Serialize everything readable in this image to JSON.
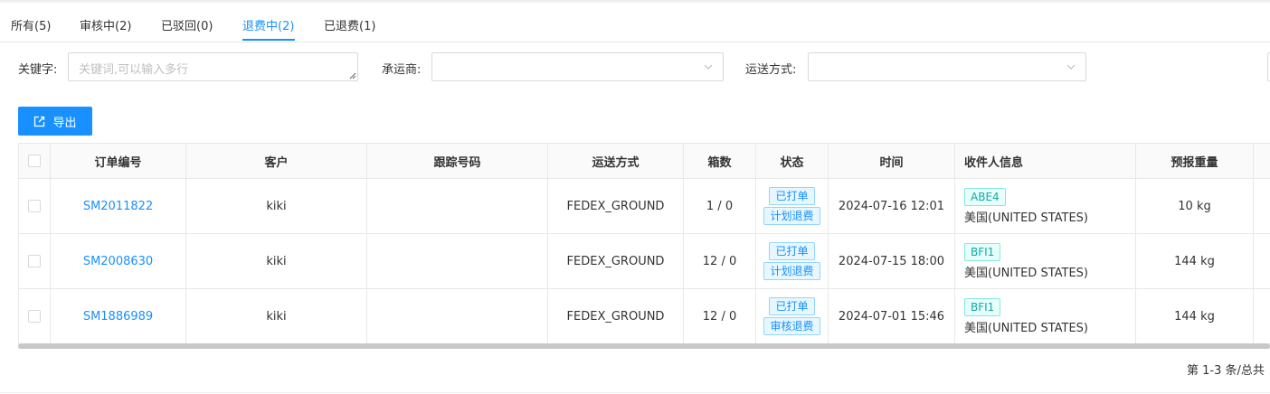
{
  "tabs": [
    {
      "label": "所有(5)",
      "active": false
    },
    {
      "label": "审核中(2)",
      "active": false
    },
    {
      "label": "已驳回(0)",
      "active": false
    },
    {
      "label": "退费中(2)",
      "active": true
    },
    {
      "label": "已退费(1)",
      "active": false
    }
  ],
  "filters": {
    "keyword_label": "关键字:",
    "keyword_placeholder": "关键词,可以输入多行",
    "carrier_label": "承运商:",
    "shipping_label": "运送方式:"
  },
  "toolbar": {
    "export_label": "导出"
  },
  "table": {
    "columns": [
      "订单编号",
      "客户",
      "跟踪号码",
      "运送方式",
      "箱数",
      "状态",
      "时间",
      "收件人信息",
      "预报重量"
    ],
    "rows": [
      {
        "order_no": "SM2011822",
        "customer": "kiki",
        "tracking": "",
        "shipping": "FEDEX_GROUND",
        "boxes": "1 / 0",
        "status1": "已打单",
        "status2": "计划退费",
        "time": "2024-07-16 12:01",
        "recv_code": "ABE4",
        "recv_country": "美国(UNITED STATES)",
        "weight": "10 kg"
      },
      {
        "order_no": "SM2008630",
        "customer": "kiki",
        "tracking": "",
        "shipping": "FEDEX_GROUND",
        "boxes": "12 / 0",
        "status1": "已打单",
        "status2": "计划退费",
        "time": "2024-07-15 18:00",
        "recv_code": "BFI1",
        "recv_country": "美国(UNITED STATES)",
        "weight": "144 kg"
      },
      {
        "order_no": "SM1886989",
        "customer": "kiki",
        "tracking": "",
        "shipping": "FEDEX_GROUND",
        "boxes": "12 / 0",
        "status1": "已打单",
        "status2": "审核退费",
        "time": "2024-07-01 15:46",
        "recv_code": "BFI1",
        "recv_country": "美国(UNITED STATES)",
        "weight": "144 kg"
      }
    ]
  },
  "pagination": {
    "summary": "第 1-3 条/总共"
  },
  "colors": {
    "primary": "#1890ff",
    "tag_cyan": "#13a8a8"
  }
}
